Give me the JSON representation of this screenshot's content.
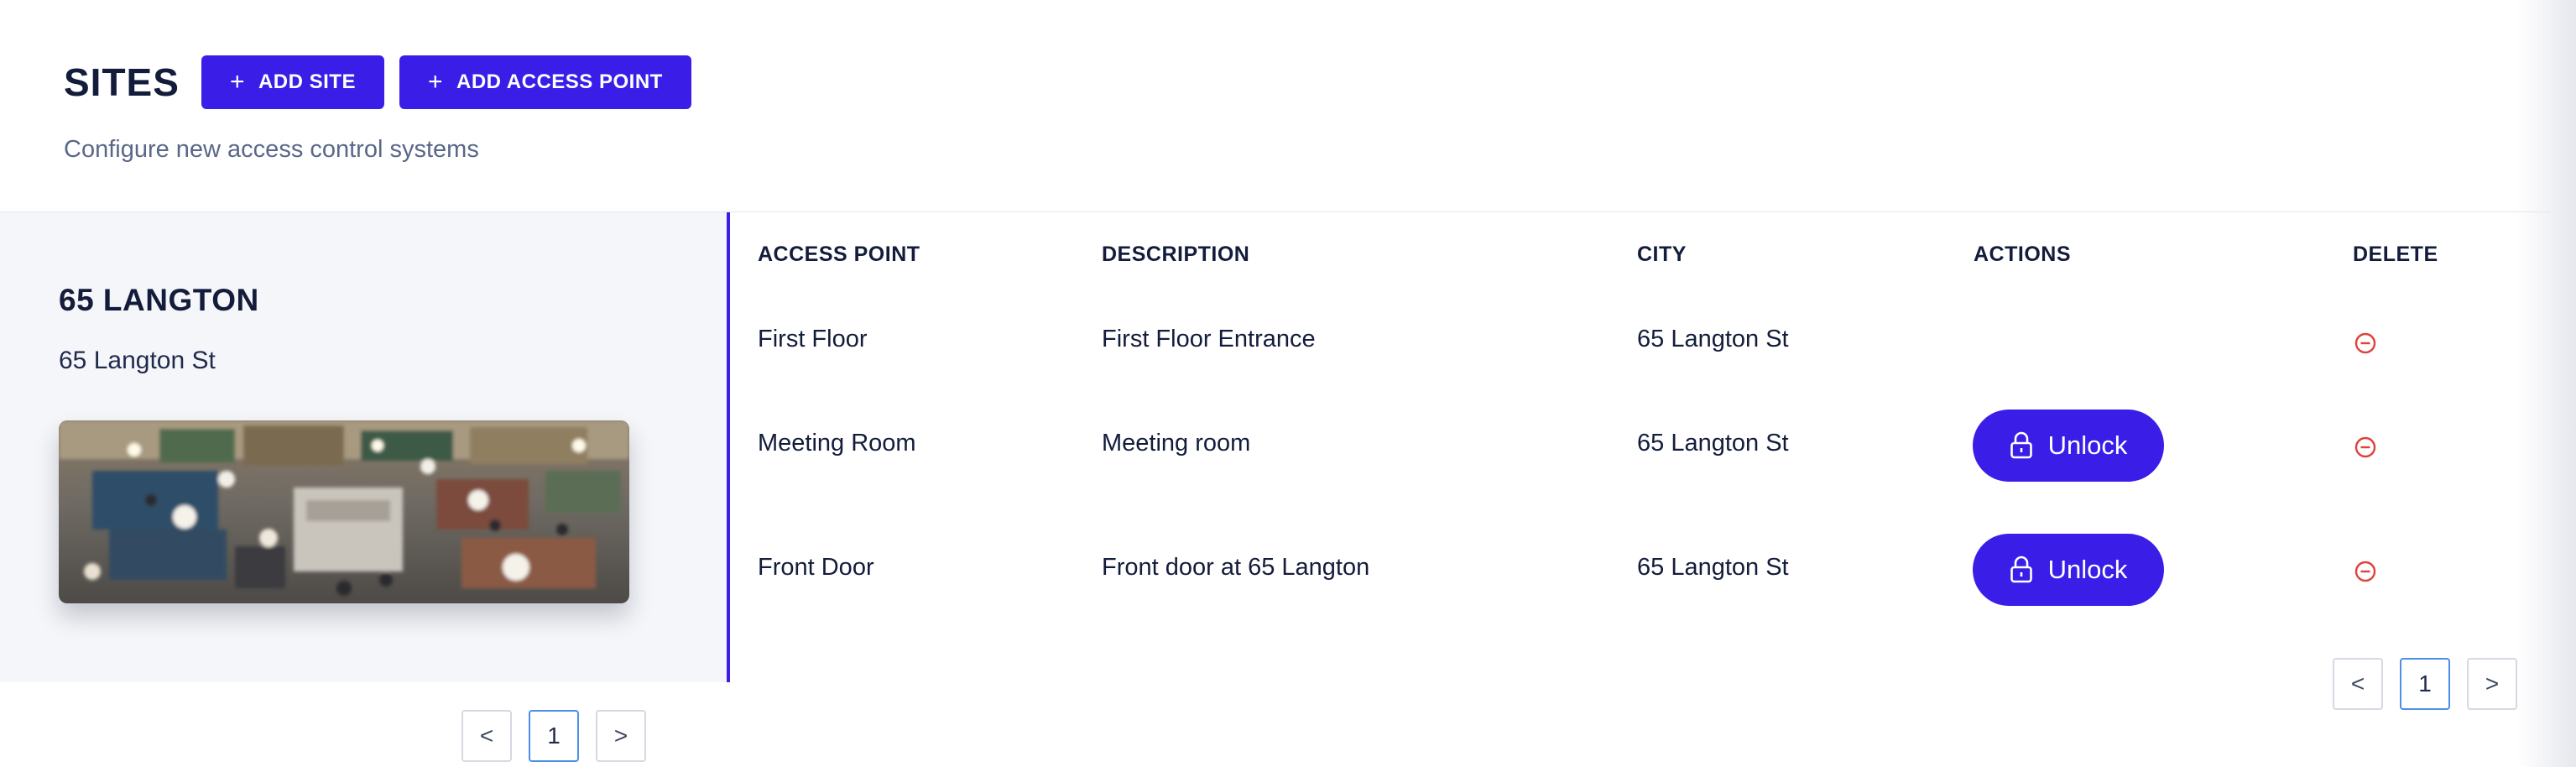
{
  "header": {
    "title": "SITES",
    "add_site_label": "ADD SITE",
    "add_access_point_label": "ADD ACCESS POINT",
    "subtitle": "Configure new access control systems"
  },
  "site": {
    "name": "65 LANGTON",
    "address": "65 Langton St",
    "pagination": {
      "prev": "<",
      "current": "1",
      "next": ">"
    }
  },
  "table": {
    "columns": {
      "access_point": "ACCESS POINT",
      "description": "DESCRIPTION",
      "city": "CITY",
      "actions": "ACTIONS",
      "delete": "DELETE"
    },
    "rows": [
      {
        "access_point": "First Floor",
        "description": "First Floor Entrance",
        "city": "65 Langton St",
        "action": ""
      },
      {
        "access_point": "Meeting Room",
        "description": "Meeting room",
        "city": "65 Langton St",
        "action": "Unlock"
      },
      {
        "access_point": "Front Door",
        "description": "Front door at 65 Langton",
        "city": "65 Langton St",
        "action": "Unlock"
      }
    ],
    "pagination": {
      "prev": "<",
      "current": "1",
      "next": ">"
    }
  },
  "colors": {
    "accent": "#3a1ee8",
    "delete": "#e0403a",
    "panel": "#f5f6f9"
  }
}
